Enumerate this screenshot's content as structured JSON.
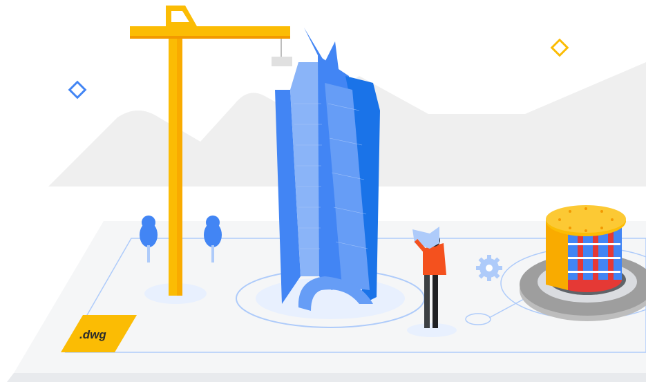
{
  "file_tag": {
    "label": ".dwg"
  },
  "colors": {
    "crane": "#fbbc04",
    "tower_main": "#4285f4",
    "tower_dark": "#1a73e8",
    "tower_light": "#8ab4f8",
    "accent_orange": "#fbbc04",
    "accent_blue": "#4285f4",
    "person_shirt": "#f4511e",
    "gear": "#bdbdbd",
    "ground": "#f8f9fa",
    "mountains": "#eeeeee"
  },
  "icons": [
    "crane-icon",
    "skyscraper-icon",
    "person-with-blueprint-icon",
    "generator-on-gear-icon",
    "small-gear-icon",
    "tree-icon",
    "diamond-icon"
  ]
}
